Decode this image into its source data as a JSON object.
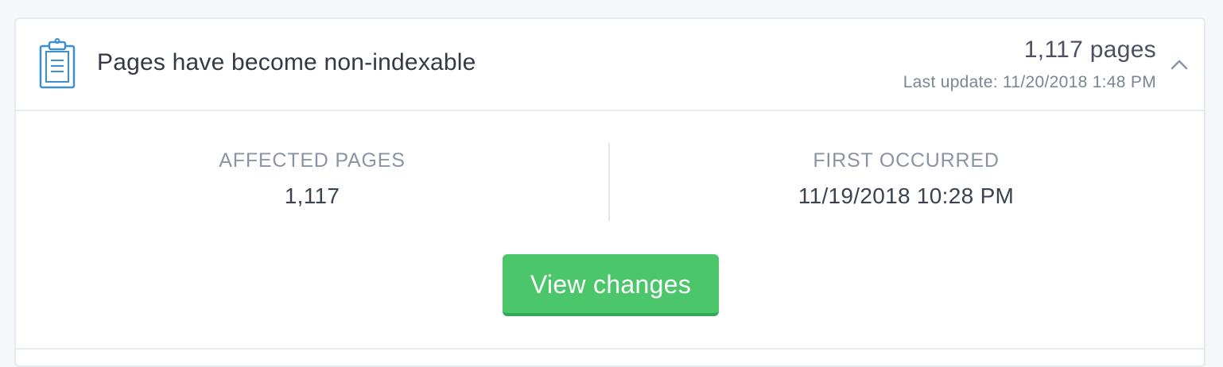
{
  "issue": {
    "title": "Pages have become non-indexable",
    "count": "1,117 pages",
    "last_update": "Last update: 11/20/2018 1:48 PM",
    "icon": "clipboard-icon",
    "toggle_icon": "chevron-up-icon"
  },
  "stats": {
    "affected_label": "AFFECTED PAGES",
    "affected_value": "1,117",
    "first_label": "FIRST OCCURRED",
    "first_value": "11/19/2018 10:28 PM"
  },
  "actions": {
    "view_changes_label": "View changes"
  },
  "colors": {
    "accent_green": "#4bc66b",
    "icon_blue": "#3d8fd0"
  }
}
